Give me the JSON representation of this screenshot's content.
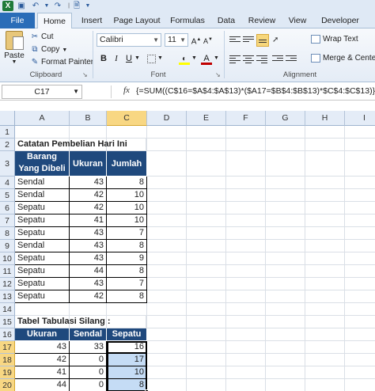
{
  "tabs": {
    "file": "File",
    "home": "Home",
    "insert": "Insert",
    "page_layout": "Page Layout",
    "formulas": "Formulas",
    "data": "Data",
    "review": "Review",
    "view": "View",
    "developer": "Developer"
  },
  "clipboard": {
    "paste": "Paste",
    "cut": "Cut",
    "copy": "Copy",
    "format_painter": "Format Painter",
    "label": "Clipboard"
  },
  "font": {
    "name": "Calibri",
    "size": "11",
    "label": "Font",
    "bold": "B",
    "italic": "I",
    "underline": "U",
    "fill_color": "#ffff00",
    "font_color": "#c00000"
  },
  "alignment": {
    "wrap_text": "Wrap Text",
    "merge_center": "Merge & Center",
    "label": "Alignment"
  },
  "formula_bar": {
    "name_box": "C17",
    "fx": "fx",
    "formula": "{=SUM((C$16=$A$4:$A$13)*($A17=$B$4:$B$13)*$C$4:$C$13)}"
  },
  "columns": [
    "A",
    "B",
    "C",
    "D",
    "E",
    "F",
    "G",
    "H",
    "I"
  ],
  "rows": [
    "1",
    "2",
    "3",
    "4",
    "5",
    "6",
    "7",
    "8",
    "9",
    "10",
    "11",
    "12",
    "13",
    "14",
    "15",
    "16",
    "17",
    "18",
    "19",
    "20"
  ],
  "sheet": {
    "title": "Catatan Pembelian Hari Ini",
    "table1_header": [
      "Barang Yang Dibeli",
      "Ukuran",
      "Jumlah"
    ],
    "table1_rows": [
      [
        "Sendal",
        "43",
        "8"
      ],
      [
        "Sendal",
        "42",
        "10"
      ],
      [
        "Sepatu",
        "42",
        "10"
      ],
      [
        "Sepatu",
        "41",
        "10"
      ],
      [
        "Sepatu",
        "43",
        "7"
      ],
      [
        "Sendal",
        "43",
        "8"
      ],
      [
        "Sepatu",
        "43",
        "9"
      ],
      [
        "Sepatu",
        "44",
        "8"
      ],
      [
        "Sepatu",
        "43",
        "7"
      ],
      [
        "Sepatu",
        "42",
        "8"
      ]
    ],
    "table2_title": "Tabel Tabulasi Silang :",
    "table2_header": [
      "Ukuran",
      "Sendal",
      "Sepatu"
    ],
    "table2_rows": [
      [
        "43",
        "33",
        "16"
      ],
      [
        "42",
        "0",
        "17"
      ],
      [
        "41",
        "0",
        "10"
      ],
      [
        "44",
        "0",
        "8"
      ]
    ]
  }
}
